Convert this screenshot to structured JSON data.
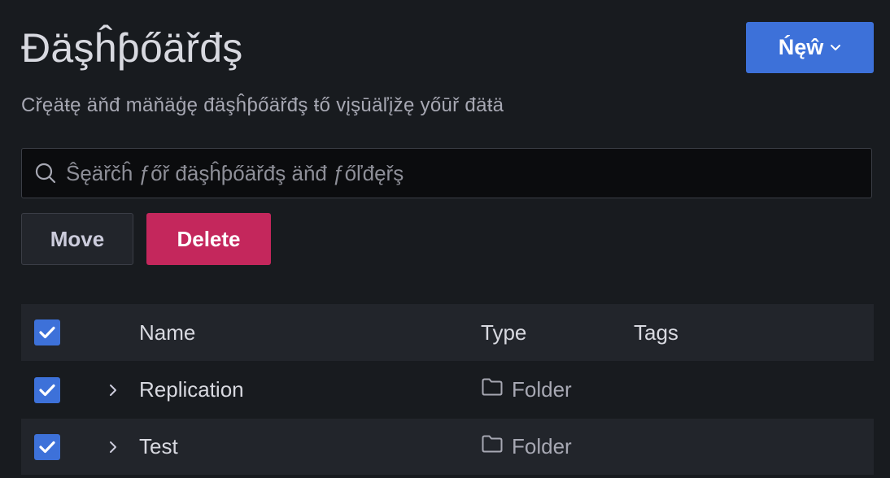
{
  "header": {
    "title": "Đäşĥƥőäřđş",
    "new_label": "Ńęŵ",
    "subtitle": "Cřęäŧę äňđ mäňäģę đäşĥƥőäřđş ŧő vįşūäľįžę yőūř đäŧä"
  },
  "search": {
    "placeholder": "Ŝęäřčĥ ƒőř đäşĥƥőäřđş äňđ ƒőľđęřş",
    "value": ""
  },
  "actions": {
    "move_label": "Move",
    "delete_label": "Delete"
  },
  "table": {
    "columns": {
      "name": "Name",
      "type": "Type",
      "tags": "Tags"
    },
    "rows": [
      {
        "name": "Replication",
        "type": "Folder",
        "checked": true
      },
      {
        "name": "Test",
        "type": "Folder",
        "checked": true
      }
    ]
  },
  "colors": {
    "primary": "#3d71d9",
    "destructive": "#c4275c",
    "background": "#181b1f"
  }
}
